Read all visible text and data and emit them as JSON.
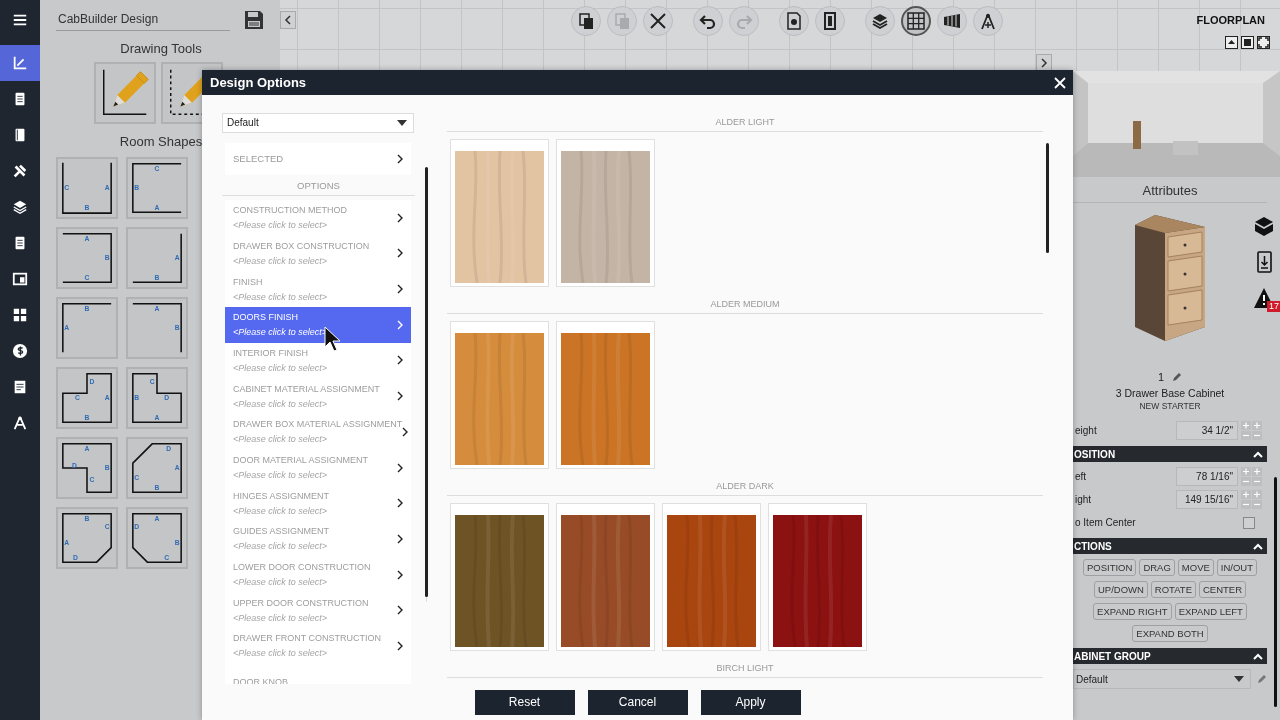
{
  "nav_rail": [
    {
      "kind": "menu",
      "selected": false
    },
    {
      "kind": "chart",
      "selected": true
    },
    {
      "kind": "document",
      "selected": false
    },
    {
      "kind": "book",
      "selected": false
    },
    {
      "kind": "tools",
      "selected": false
    },
    {
      "kind": "layers",
      "selected": false
    },
    {
      "kind": "document",
      "selected": false
    },
    {
      "kind": "window",
      "selected": false
    },
    {
      "kind": "grid",
      "selected": false
    },
    {
      "kind": "dollar",
      "selected": false
    },
    {
      "kind": "report",
      "selected": false
    },
    {
      "kind": "compass",
      "selected": false
    }
  ],
  "left_panel": {
    "design_name": "CabBuilder Design",
    "drawing_tools_title": "Drawing Tools",
    "drawing_tools": [
      {
        "kind": "solid"
      },
      {
        "kind": "dashed"
      }
    ],
    "room_shapes_title": "Room Shapes",
    "room_shapes": [
      {
        "kind": "open-top",
        "labels": [
          "C",
          "A",
          "B"
        ]
      },
      {
        "kind": "open-right",
        "labels": [
          "C",
          "B",
          "A"
        ]
      },
      {
        "kind": "open-left",
        "labels": [
          "A",
          "B",
          "C"
        ]
      },
      {
        "kind": "corner-br",
        "labels": [
          "A",
          "B"
        ]
      },
      {
        "kind": "corner-tl",
        "labels": [
          "B",
          "A"
        ]
      },
      {
        "kind": "corner-tr",
        "labels": [
          "A",
          "B"
        ]
      },
      {
        "kind": "notch-tl",
        "labels": [
          "D",
          "C",
          "A",
          "B"
        ]
      },
      {
        "kind": "notch-tr",
        "labels": [
          "C",
          "B",
          "D",
          "A"
        ]
      },
      {
        "kind": "notch-bl",
        "labels": [
          "A",
          "D",
          "B",
          "C"
        ]
      },
      {
        "kind": "chamfer-tl",
        "labels": [
          "D",
          "A",
          "C",
          "B"
        ]
      },
      {
        "kind": "chamfer-br",
        "labels": [
          "B",
          "C",
          "A",
          "D"
        ]
      },
      {
        "kind": "chamfer-bl",
        "labels": [
          "A",
          "D",
          "B",
          "C"
        ]
      }
    ]
  },
  "canvas": {
    "toolbar": [
      {
        "kind": "copy",
        "disabled": false,
        "selected": false
      },
      {
        "kind": "paste",
        "disabled": true,
        "selected": false
      },
      {
        "kind": "delete",
        "disabled": false,
        "selected": false
      },
      {
        "kind": "undo",
        "disabled": false,
        "selected": false
      },
      {
        "kind": "redo",
        "disabled": true,
        "selected": false
      },
      {
        "kind": "page-settings",
        "disabled": false,
        "selected": false
      },
      {
        "kind": "door",
        "disabled": false,
        "selected": false
      },
      {
        "kind": "layers",
        "disabled": false,
        "selected": false
      },
      {
        "kind": "grid",
        "disabled": false,
        "selected": true
      },
      {
        "kind": "wall",
        "disabled": false,
        "selected": false
      },
      {
        "kind": "compass",
        "disabled": false,
        "selected": false
      }
    ],
    "view_label": "FLOORPLAN"
  },
  "attributes": {
    "title": "Attributes",
    "badge": "17",
    "item_number": "1",
    "item_name": "3 Drawer Base Cabinet",
    "item_style": "NEW STARTER",
    "height": {
      "label": "eight",
      "value": "34 1/2\""
    },
    "sections": [
      {
        "title": "OSITION",
        "expanded": true,
        "rows": [
          {
            "kind": "number",
            "label": "eft",
            "value": "78 1/16\""
          },
          {
            "kind": "number",
            "label": "ight",
            "value": "149 15/16\""
          },
          {
            "kind": "checkbox",
            "label": "o Item Center",
            "checked": false
          }
        ]
      },
      {
        "title": "CTIONS",
        "expanded": true,
        "buttons": [
          "POSITION",
          "DRAG",
          "MOVE",
          "IN/OUT",
          "UP/DOWN",
          "ROTATE",
          "CENTER",
          "EXPAND RIGHT",
          "EXPAND LEFT",
          "EXPAND BOTH"
        ]
      },
      {
        "title": "ABINET GROUP",
        "expanded": true,
        "select": "Default"
      }
    ]
  },
  "dialog": {
    "title": "Design Options",
    "preset": "Default",
    "selected_row": "SELECTED",
    "options_header": "OPTIONS",
    "options": [
      {
        "title": "CONSTRUCTION METHOD",
        "subtitle": "<Please click to select>",
        "selected": false
      },
      {
        "title": "DRAWER BOX CONSTRUCTION",
        "subtitle": "<Please click to select>",
        "selected": false
      },
      {
        "title": "FINISH",
        "subtitle": "<Please click to select>",
        "selected": false
      },
      {
        "title": "DOORS FINISH",
        "subtitle": "<Please click to select>",
        "selected": true
      },
      {
        "title": "INTERIOR FINISH",
        "subtitle": "<Please click to select>",
        "selected": false
      },
      {
        "title": "CABINET MATERIAL ASSIGNMENT",
        "subtitle": "<Please click to select>",
        "selected": false
      },
      {
        "title": "DRAWER BOX MATERIAL ASSIGNMENT",
        "subtitle": "<Please click to select>",
        "selected": false
      },
      {
        "title": "DOOR MATERIAL ASSIGNMENT",
        "subtitle": "<Please click to select>",
        "selected": false
      },
      {
        "title": "HINGES ASSIGNMENT",
        "subtitle": "<Please click to select>",
        "selected": false
      },
      {
        "title": "GUIDES ASSIGNMENT",
        "subtitle": "<Please click to select>",
        "selected": false
      },
      {
        "title": "LOWER DOOR CONSTRUCTION",
        "subtitle": "<Please click to select>",
        "selected": false
      },
      {
        "title": "UPPER DOOR CONSTRUCTION",
        "subtitle": "<Please click to select>",
        "selected": false
      },
      {
        "title": "DRAWER FRONT CONSTRUCTION",
        "subtitle": "<Please click to select>",
        "selected": false
      },
      {
        "title": "DOOR KNOB",
        "selected": false
      }
    ],
    "swatch_groups": [
      {
        "name": "ALDER LIGHT",
        "swatches": [
          {
            "color": "#e2c3a2"
          },
          {
            "color": "#c4b4a6"
          }
        ]
      },
      {
        "name": "ALDER MEDIUM",
        "swatches": [
          {
            "color": "#d58c3c"
          },
          {
            "color": "#cb7425"
          }
        ]
      },
      {
        "name": "ALDER DARK",
        "swatches": [
          {
            "color": "#6e5324"
          },
          {
            "color": "#974c27"
          },
          {
            "color": "#a9450f"
          },
          {
            "color": "#8c1111"
          }
        ]
      },
      {
        "name": "BIRCH LIGHT"
      }
    ],
    "buttons": [
      "Reset",
      "Cancel",
      "Apply"
    ]
  }
}
